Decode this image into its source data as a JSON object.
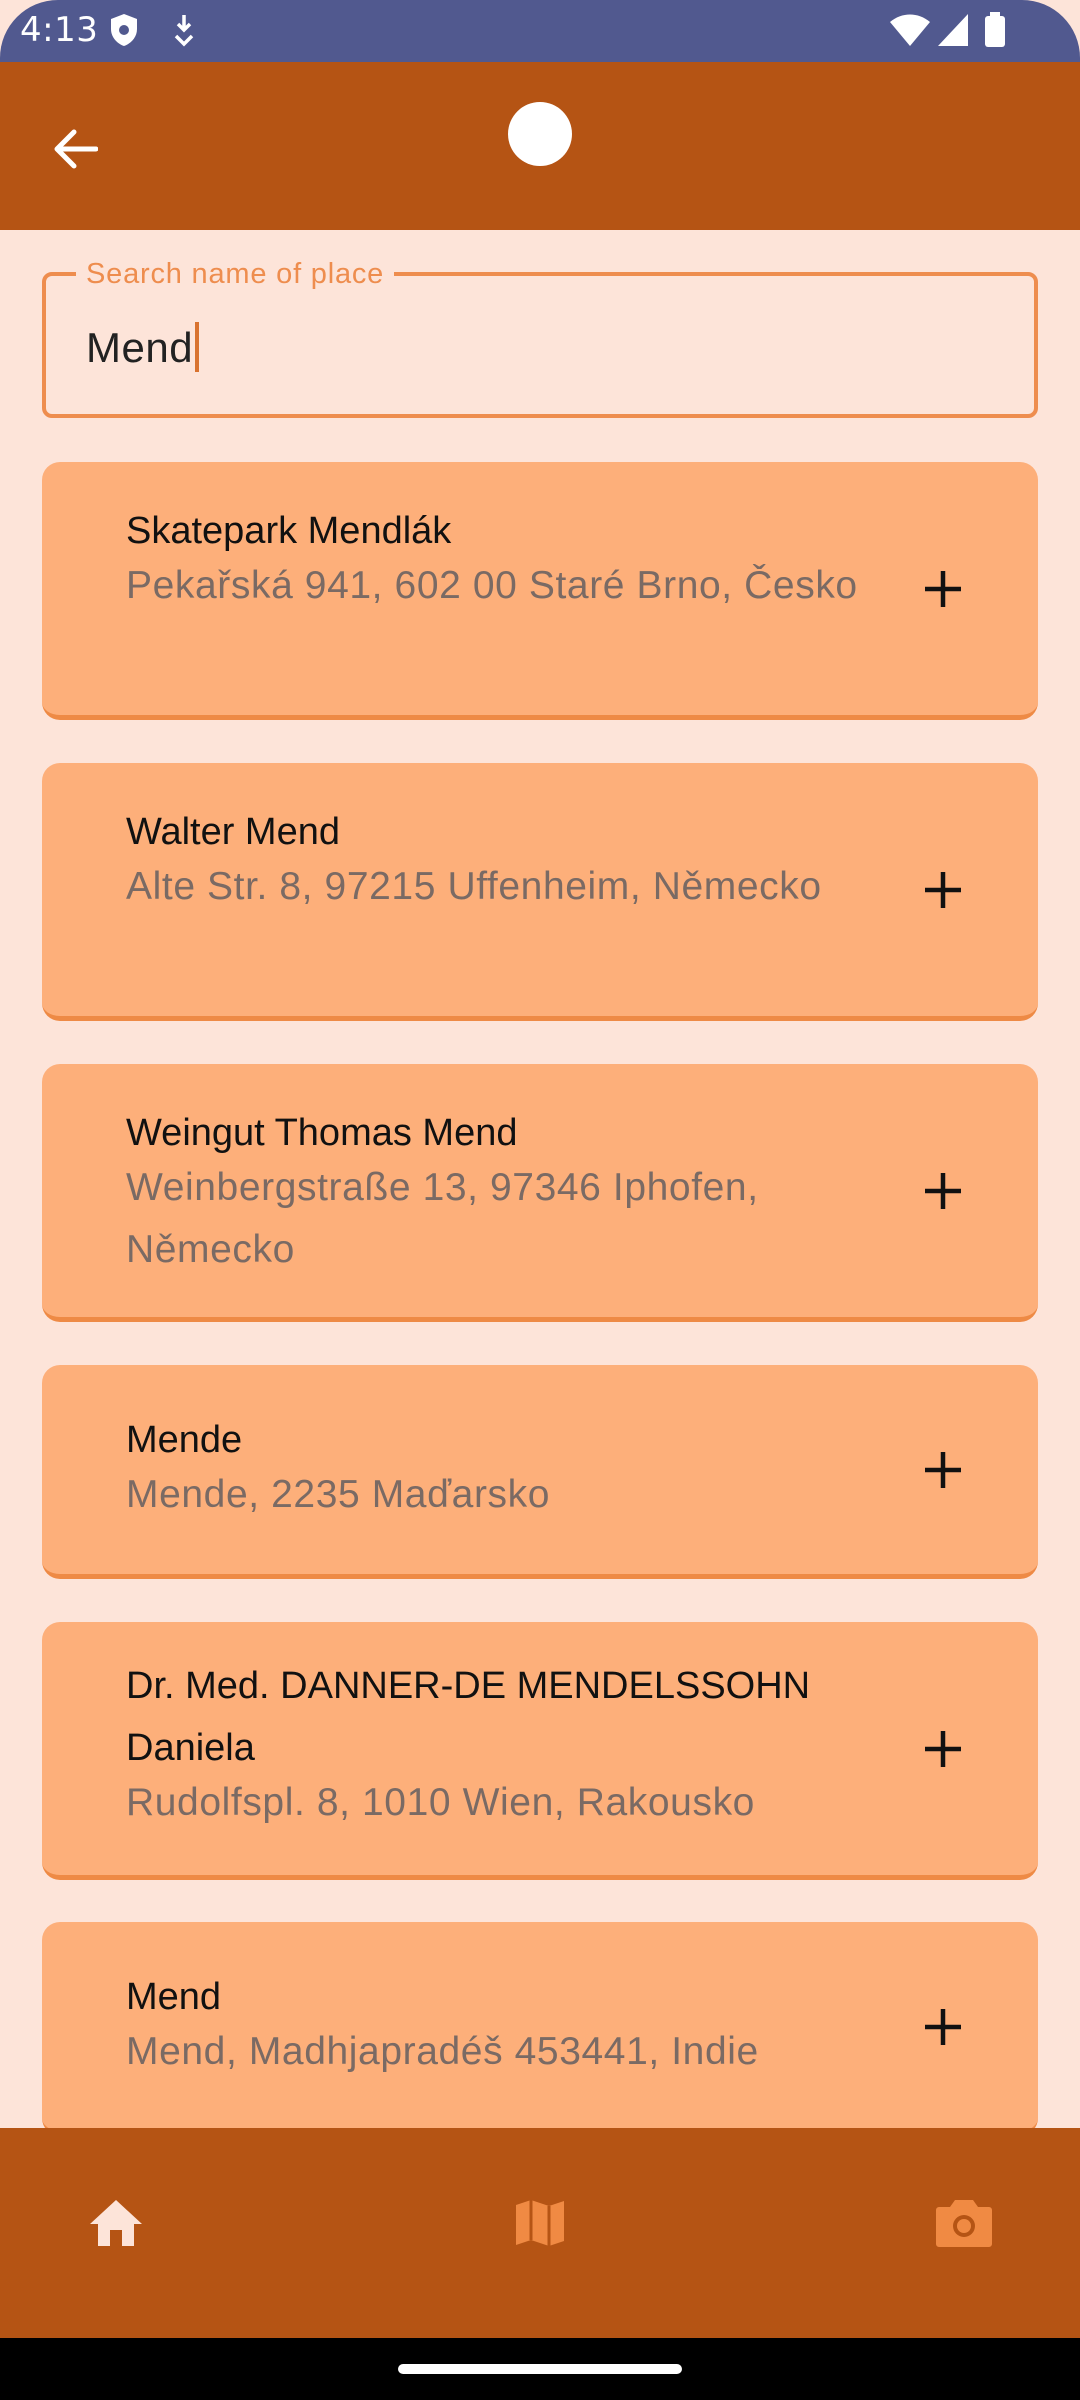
{
  "status_bar": {
    "time": "4:13",
    "icons": [
      "shield-icon",
      "download-icon",
      "wifi-icon",
      "signal-icon",
      "battery-icon"
    ]
  },
  "app_bar": {
    "back_icon": "arrow-left-icon"
  },
  "search": {
    "label": "Search name of place",
    "value": "Mend"
  },
  "results": [
    {
      "name": "Skatepark Mendlák",
      "address": "Pekařská 941, 602 00 Staré Brno, Česko"
    },
    {
      "name": "Walter Mend",
      "address": "Alte Str. 8, 97215 Uffenheim, Německo"
    },
    {
      "name": "Weingut Thomas Mend",
      "address": "Weinbergstraße 13, 97346 Iphofen, Německo"
    },
    {
      "name": "Mende",
      "address": "Mende, 2235 Maďarsko"
    },
    {
      "name": "Dr. Med. DANNER-DE MENDELSSOHN Daniela",
      "address": "Rudolfspl. 8, 1010 Wien, Rakousko"
    },
    {
      "name": "Mend",
      "address": "Mend, Madhjapradéš 453441, Indie"
    }
  ],
  "bottom_nav": {
    "items": [
      {
        "icon": "home-icon",
        "active": true
      },
      {
        "icon": "map-icon",
        "active": false
      },
      {
        "icon": "camera-icon",
        "active": false
      }
    ]
  },
  "colors": {
    "status_bar": "#51598f",
    "primary": "#b55414",
    "background": "#fde4d9",
    "card": "#fdaf7a",
    "accent": "#ee8d4e"
  }
}
